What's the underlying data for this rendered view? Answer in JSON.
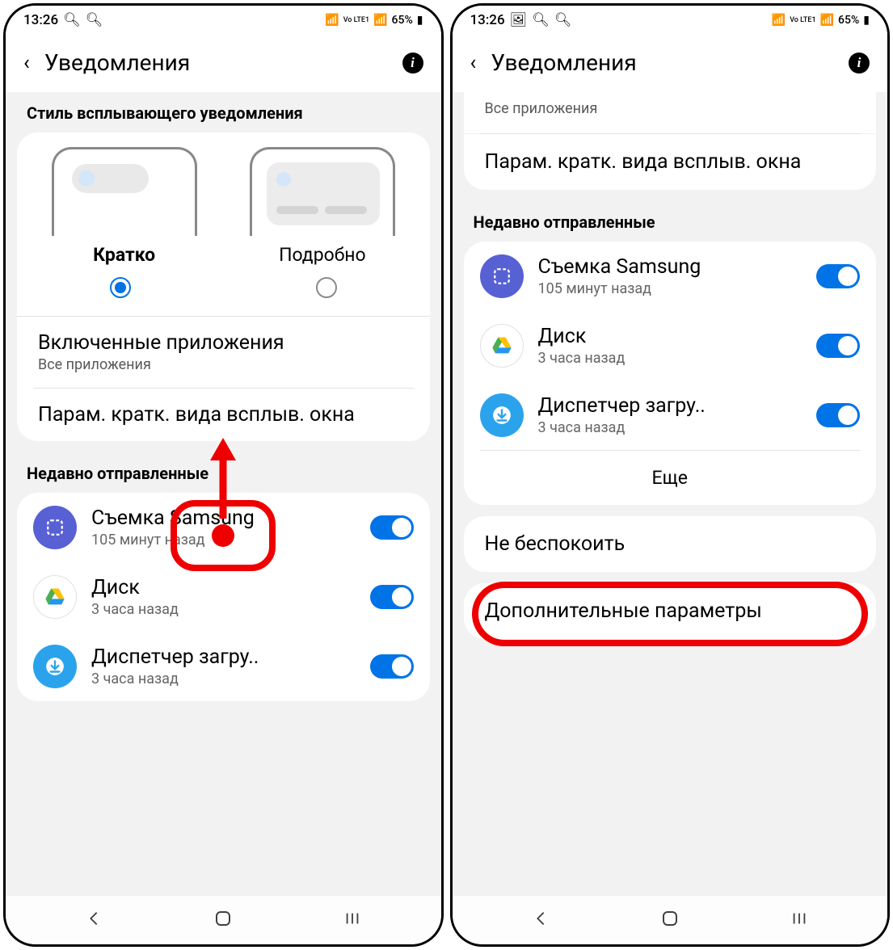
{
  "status": {
    "time": "13:26",
    "battery": "65%",
    "lte": "Vo LTE1"
  },
  "header": {
    "title": "Уведомления"
  },
  "left": {
    "section_style": "Стиль всплывающего уведомления",
    "style_brief": "Кратко",
    "style_detail": "Подробно",
    "enabled_apps_title": "Включенные приложения",
    "enabled_apps_sub": "Все приложения",
    "popup_params": "Парам. кратк. вида всплыв. окна",
    "recent_label": "Недавно отправленные",
    "apps": [
      {
        "name": "Съемка Samsung",
        "time": "105 минут назад"
      },
      {
        "name": "Диск",
        "time": "3 часа назад"
      },
      {
        "name": "Диспетчер загру..",
        "time": "3 часа назад"
      }
    ]
  },
  "right": {
    "all_apps": "Все приложения",
    "popup_params": "Парам. кратк. вида всплыв. окна",
    "recent_label": "Недавно отправленные",
    "apps": [
      {
        "name": "Съемка Samsung",
        "time": "105 минут назад"
      },
      {
        "name": "Диск",
        "time": "3 часа назад"
      },
      {
        "name": "Диспетчер загру..",
        "time": "3 часа назад"
      }
    ],
    "more": "Еще",
    "dnd": "Не беспокоить",
    "advanced": "Дополнительные параметры"
  }
}
